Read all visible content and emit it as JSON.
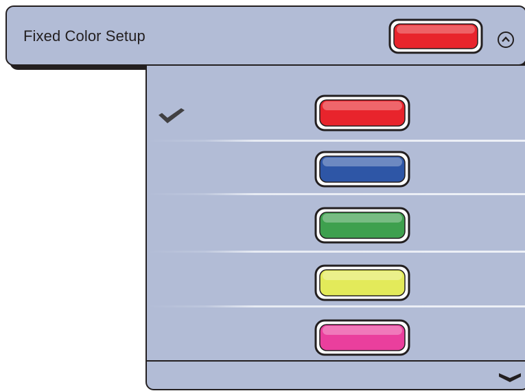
{
  "header": {
    "title": "Fixed Color Setup",
    "selected_color": "#e8242c",
    "collapse_icon": "chevron-up-circle-icon"
  },
  "options": [
    {
      "color": "#e8242c",
      "selected": true
    },
    {
      "color": "#2e56a6",
      "selected": false
    },
    {
      "color": "#3ea04e",
      "selected": false
    },
    {
      "color": "#e3ea5a",
      "selected": false
    },
    {
      "color": "#ea3f9d",
      "selected": false
    }
  ],
  "icons": {
    "selected": "checkmark-icon",
    "more": "chevron-down-icon"
  },
  "colors": {
    "panel_bg": "#b2bcd6",
    "outline": "#231f20"
  }
}
